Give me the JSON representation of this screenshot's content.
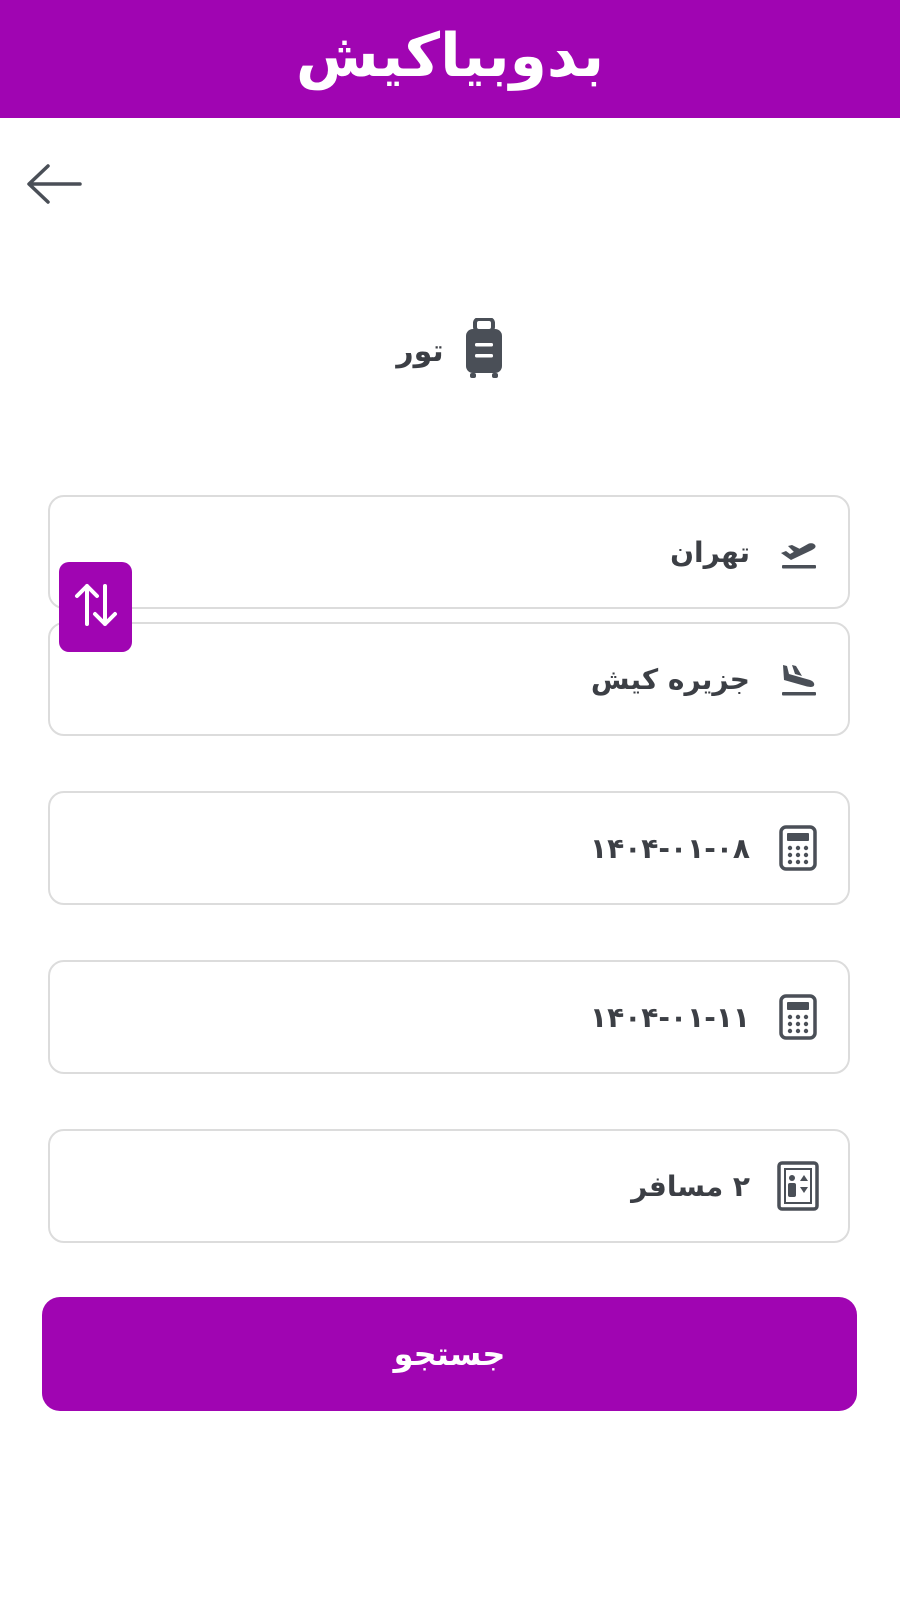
{
  "header": {
    "logo_text": "بدوبیاکیش"
  },
  "nav": {
    "back_icon": "arrow-left-icon"
  },
  "section": {
    "title": "تور",
    "icon": "luggage-icon"
  },
  "form": {
    "origin": {
      "value": "تهران",
      "icon": "plane-takeoff-icon"
    },
    "destination": {
      "value": "جزیره کیش",
      "icon": "plane-landing-icon"
    },
    "swap_icon": "swap-vertical-icon",
    "depart_date": {
      "value": "۱۴۰۴-۰۱-۰۸",
      "icon": "calendar-icon"
    },
    "return_date": {
      "value": "۱۴۰۴-۰۱-۱۱",
      "icon": "calendar-icon"
    },
    "passengers": {
      "value": "۲ مسافر",
      "icon": "passenger-icon"
    }
  },
  "search": {
    "label": "جستجو"
  },
  "colors": {
    "brand": "#a005b2",
    "text": "#3c3f45",
    "border": "#dcdcdc",
    "icon": "#4a4f57"
  }
}
